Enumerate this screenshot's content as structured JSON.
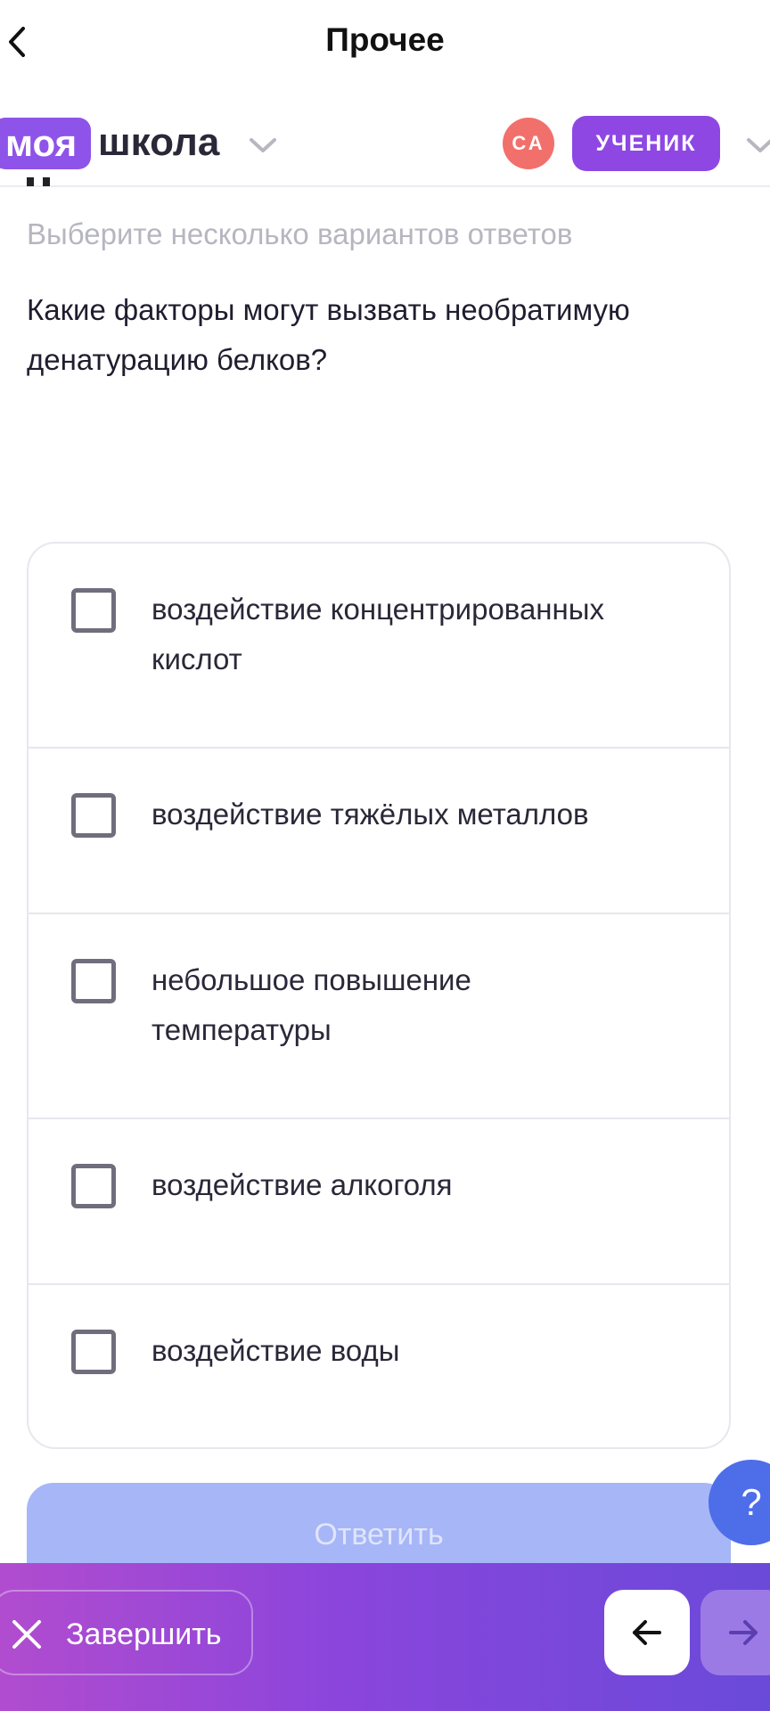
{
  "nav": {
    "title": "Прочее"
  },
  "header": {
    "logo_part1": "моя",
    "logo_part2": "школа",
    "avatar_initials": "СА",
    "role": "УЧЕНИК"
  },
  "task": {
    "hint": "Выберите несколько вариантов ответов",
    "question": "Какие факторы могут вызвать необратимую денатурацию белков?"
  },
  "options": [
    {
      "label": "воздействие концентрированных кислот",
      "checked": false
    },
    {
      "label": "воздействие тяжёлых металлов",
      "checked": false
    },
    {
      "label": "небольшое повышение температуры",
      "checked": false
    },
    {
      "label": "воздействие алкоголя",
      "checked": false
    },
    {
      "label": "воздействие воды",
      "checked": false
    }
  ],
  "answer_button": "Ответить",
  "help_button": "?",
  "footer": {
    "finish_label": "Завершить"
  },
  "colors": {
    "brand_purple": "#8e54e9",
    "avatar_red": "#f2706b",
    "answer_disabled": "#a7b6f7",
    "help_blue": "#4d6ee8"
  }
}
